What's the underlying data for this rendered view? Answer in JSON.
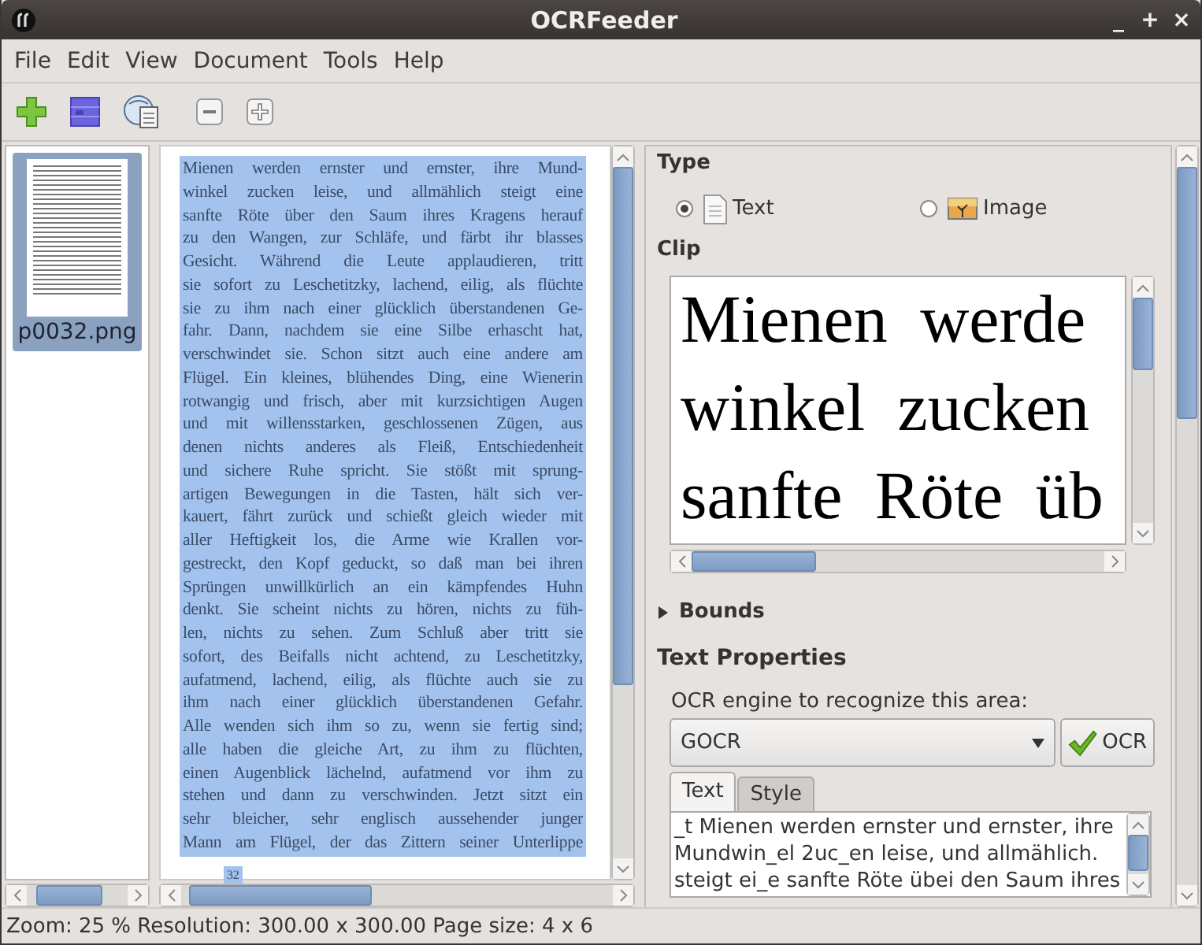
{
  "window": {
    "title": "OCRFeeder",
    "controls": [
      "_",
      "+",
      "×"
    ]
  },
  "menu": [
    "File",
    "Edit",
    "View",
    "Document",
    "Tools",
    "Help"
  ],
  "pages": [
    {
      "label": "p0032.png",
      "selected": true
    }
  ],
  "areas": [
    {
      "selected": true,
      "lines": [
        "Mienen werden ernster und ernster, ihre Mund-",
        "winkel zucken leise, und allmählich steigt eine",
        "sanfte Röte über den Saum ihres Kragens herauf",
        "zu den Wangen, zur Schläfe, und färbt ihr blasses",
        "Gesicht. Während die Leute applaudieren, tritt",
        "sie sofort zu Leschetitzky, lachend, eilig, als flüchte",
        "sie zu ihm nach einer glücklich überstandenen Ge-",
        "fahr. Dann, nachdem sie eine Silbe erhascht hat,",
        "verschwindet sie. Schon sitzt auch eine andere am",
        "Flügel. Ein kleines, blühendes Ding, eine Wienerin",
        "rotwangig und frisch, aber mit kurzsichtigen Augen",
        "und mit willensstarken, geschlossenen Zügen, aus",
        "denen nichts anderes als Fleiß, Entschiedenheit",
        "und sichere Ruhe spricht. Sie stößt mit sprung-",
        "artigen Bewegungen in die Tasten, hält sich ver-",
        "kauert, fährt zurück und schießt gleich wieder mit",
        "aller Heftigkeit los, die Arme wie Krallen vor-",
        "gestreckt, den Kopf geduckt, so daß man bei ihren",
        "Sprüngen unwillkürlich an ein kämpfendes Huhn",
        "denkt. Sie scheint nichts zu hören, nichts zu füh-",
        "len, nichts zu sehen. Zum Schluß aber tritt sie",
        "sofort, des Beifalls nicht achtend, zu Leschetitzky,",
        "aufatmend, lachend, eilig, als flüchte auch sie zu",
        "ihm nach einer glücklich überstandenen Gefahr.",
        "Alle wenden sich ihm so zu, wenn sie fertig sind;",
        "alle haben die gleiche Art, zu ihm zu flüchten,",
        "einen Augenblick lächelnd, aufatmend vor ihm zu",
        "stehen und dann zu verschwinden. Jetzt sitzt ein",
        "sehr bleicher, sehr englisch aussehender junger",
        "Mann am Flügel, der das Zittern seiner Unterlippe"
      ]
    },
    {
      "selected": true,
      "lines": [
        "32"
      ]
    }
  ],
  "properties": {
    "type_heading": "Type",
    "type_options": [
      {
        "kind": "text",
        "label": "Text",
        "selected": true
      },
      {
        "kind": "image",
        "label": "Image",
        "selected": false
      }
    ],
    "clip_heading": "Clip",
    "clip_lines": [
      "Mienen werde",
      "winkel zucken",
      "sanfte Röte üb"
    ],
    "bounds": {
      "label": "Bounds",
      "expanded": false
    },
    "text_properties_heading": "Text Properties",
    "engine_label": "OCR engine to recognize this area:",
    "engine": "GOCR",
    "ocr_button": "OCR",
    "tabs": [
      {
        "label": "Text",
        "selected": true
      },
      {
        "label": "Style",
        "selected": false
      }
    ],
    "ocr_text": [
      "_t Mienen werden ernster und ernster, ihre",
      "Mundwin_el 2uc_en leise, und allmählich.",
      "steigt ei_e sanfte Röte übei den Saum ihres"
    ]
  },
  "status_bar": "Zoom: 25 % Resolution: 300.00 x 300.00 Page size: 4 x 6"
}
